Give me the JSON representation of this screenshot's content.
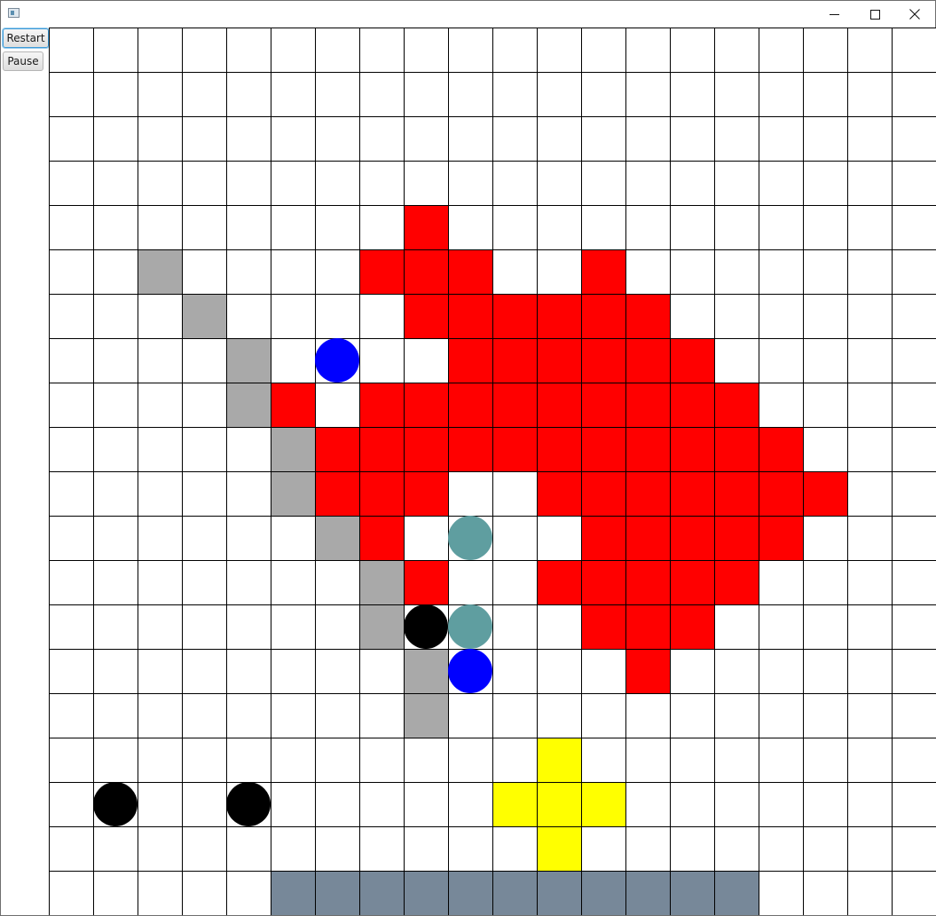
{
  "window": {
    "title": "",
    "icon": "app-window-icon",
    "controls": [
      {
        "name": "minimize-button",
        "icon": "minimize-icon"
      },
      {
        "name": "maximize-button",
        "icon": "maximize-icon"
      },
      {
        "name": "close-button",
        "icon": "close-icon"
      }
    ]
  },
  "controls": {
    "restart_label": "Restart",
    "pause_label": "Pause"
  },
  "board": {
    "columns": 20,
    "rows": 20,
    "colors": {
      "empty": "#ffffff",
      "grid_line": "#000000",
      "fire": "#ff0000",
      "wall": "#a9a9a9",
      "base": "#778899",
      "target": "#ffff00",
      "blue_unit": "#0000ff",
      "black_unit": "#000000",
      "teal_unit": "#5f9ea0"
    },
    "fire_cells": [
      [
        4,
        8
      ],
      [
        5,
        7
      ],
      [
        5,
        8
      ],
      [
        5,
        9
      ],
      [
        5,
        12
      ],
      [
        6,
        8
      ],
      [
        6,
        9
      ],
      [
        6,
        10
      ],
      [
        6,
        11
      ],
      [
        6,
        12
      ],
      [
        6,
        13
      ],
      [
        7,
        9
      ],
      [
        7,
        10
      ],
      [
        7,
        11
      ],
      [
        7,
        12
      ],
      [
        7,
        13
      ],
      [
        7,
        14
      ],
      [
        8,
        5
      ],
      [
        8,
        7
      ],
      [
        8,
        8
      ],
      [
        8,
        9
      ],
      [
        8,
        10
      ],
      [
        8,
        11
      ],
      [
        8,
        12
      ],
      [
        8,
        13
      ],
      [
        8,
        14
      ],
      [
        8,
        15
      ],
      [
        9,
        6
      ],
      [
        9,
        7
      ],
      [
        9,
        8
      ],
      [
        9,
        9
      ],
      [
        9,
        10
      ],
      [
        9,
        11
      ],
      [
        9,
        12
      ],
      [
        9,
        13
      ],
      [
        9,
        14
      ],
      [
        9,
        15
      ],
      [
        9,
        16
      ],
      [
        10,
        6
      ],
      [
        10,
        7
      ],
      [
        10,
        8
      ],
      [
        10,
        11
      ],
      [
        10,
        12
      ],
      [
        10,
        13
      ],
      [
        10,
        14
      ],
      [
        10,
        15
      ],
      [
        10,
        16
      ],
      [
        10,
        17
      ],
      [
        11,
        7
      ],
      [
        11,
        12
      ],
      [
        11,
        13
      ],
      [
        11,
        14
      ],
      [
        11,
        15
      ],
      [
        11,
        16
      ],
      [
        12,
        8
      ],
      [
        12,
        11
      ],
      [
        12,
        12
      ],
      [
        12,
        13
      ],
      [
        12,
        14
      ],
      [
        12,
        15
      ],
      [
        13,
        12
      ],
      [
        13,
        13
      ],
      [
        13,
        14
      ],
      [
        14,
        13
      ]
    ],
    "wall_cells": [
      [
        5,
        2
      ],
      [
        6,
        3
      ],
      [
        7,
        4
      ],
      [
        8,
        4
      ],
      [
        9,
        5
      ],
      [
        10,
        5
      ],
      [
        11,
        6
      ],
      [
        12,
        7
      ],
      [
        13,
        7
      ],
      [
        14,
        8
      ],
      [
        15,
        8
      ]
    ],
    "base_cells": [
      [
        19,
        5
      ],
      [
        19,
        6
      ],
      [
        19,
        7
      ],
      [
        19,
        8
      ],
      [
        19,
        9
      ],
      [
        19,
        10
      ],
      [
        19,
        11
      ],
      [
        19,
        12
      ],
      [
        19,
        13
      ],
      [
        19,
        14
      ],
      [
        19,
        15
      ]
    ],
    "target_cells": [
      [
        16,
        11
      ],
      [
        17,
        10
      ],
      [
        17,
        11
      ],
      [
        17,
        12
      ],
      [
        18,
        11
      ]
    ],
    "units": [
      {
        "type": "blue_unit",
        "row": 7,
        "col": 6
      },
      {
        "type": "teal_unit",
        "row": 11,
        "col": 9
      },
      {
        "type": "black_unit",
        "row": 13,
        "col": 8
      },
      {
        "type": "teal_unit",
        "row": 13,
        "col": 9
      },
      {
        "type": "blue_unit",
        "row": 14,
        "col": 9
      },
      {
        "type": "black_unit",
        "row": 17,
        "col": 1
      },
      {
        "type": "black_unit",
        "row": 17,
        "col": 4
      }
    ]
  }
}
